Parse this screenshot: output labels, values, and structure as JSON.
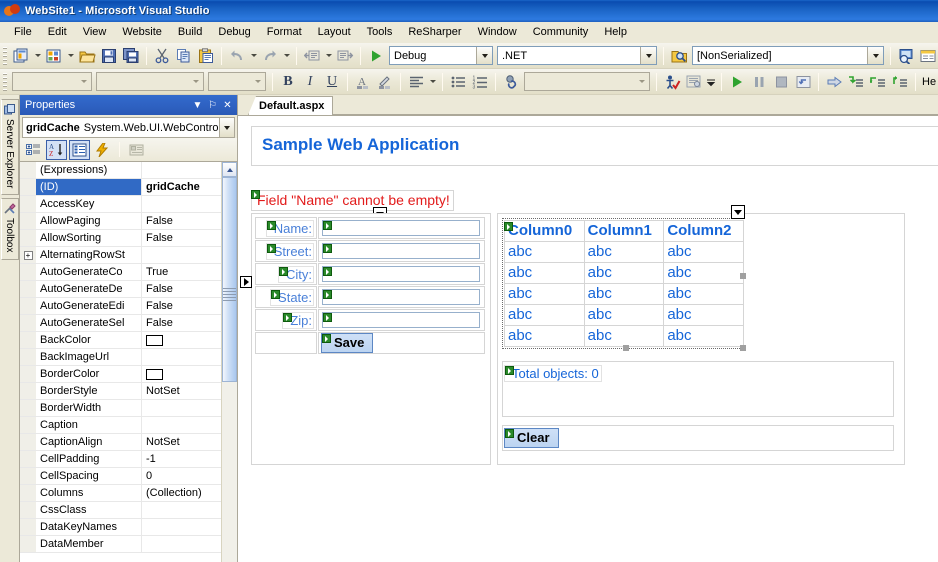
{
  "window": {
    "title": "WebSite1 - Microsoft Visual Studio",
    "logo_icon": "visual-studio-logo-icon"
  },
  "menubar": {
    "items": [
      {
        "label": "File"
      },
      {
        "label": "Edit"
      },
      {
        "label": "View"
      },
      {
        "label": "Website"
      },
      {
        "label": "Build"
      },
      {
        "label": "Debug"
      },
      {
        "label": "Format"
      },
      {
        "label": "Layout"
      },
      {
        "label": "Tools"
      },
      {
        "label": "ReSharper"
      },
      {
        "label": "Window"
      },
      {
        "label": "Community"
      },
      {
        "label": "Help"
      }
    ]
  },
  "toolbar_standard": {
    "buttons": [
      {
        "icon": "new-project-icon",
        "has_dropdown": true
      },
      {
        "icon": "new-item-icon",
        "has_dropdown": true
      },
      {
        "icon": "open-file-icon"
      },
      {
        "icon": "save-icon"
      },
      {
        "icon": "save-all-icon"
      },
      {
        "icon": "cut-icon"
      },
      {
        "icon": "copy-icon"
      },
      {
        "icon": "paste-icon"
      },
      {
        "icon": "undo-icon",
        "has_dropdown": true
      },
      {
        "icon": "redo-icon",
        "has_dropdown": true
      },
      {
        "icon": "navigate-backward-icon",
        "has_dropdown": true
      },
      {
        "icon": "navigate-forward-icon"
      },
      {
        "icon": "start-debugging-icon"
      }
    ],
    "config_combo": {
      "value": "Debug"
    },
    "platform_combo": {
      "value": ".NET"
    },
    "find_icon": "find-in-files-icon",
    "find_combo": {
      "value": "[NonSerialized]"
    },
    "right_buttons": [
      {
        "icon": "solution-explorer-icon"
      },
      {
        "icon": "properties-window-icon"
      },
      {
        "icon": "object-browser-icon"
      },
      {
        "icon": "toolbox-tools-icon"
      }
    ]
  },
  "toolbar_formatting": {
    "block_combo": {
      "value": ""
    },
    "font_combo": {
      "value": ""
    },
    "size_combo": {
      "value": ""
    },
    "buttons": [
      {
        "icon": "bold-icon",
        "label": "B"
      },
      {
        "icon": "italic-icon",
        "label": "I"
      },
      {
        "icon": "underline-icon",
        "label": "U"
      },
      {
        "icon": "foreground-color-icon"
      },
      {
        "icon": "background-color-icon"
      },
      {
        "icon": "align-left-icon",
        "has_dropdown": true
      },
      {
        "icon": "bullet-list-icon"
      },
      {
        "icon": "numbered-list-icon"
      },
      {
        "icon": "hyperlink-icon"
      }
    ],
    "style_combo": {
      "value": ""
    },
    "right_buttons": [
      {
        "icon": "accessibility-check-icon"
      },
      {
        "icon": "style-sheet-icon"
      },
      {
        "icon": "overflow-chevron-icon"
      },
      {
        "icon": "start-icon"
      },
      {
        "icon": "pause-icon"
      },
      {
        "icon": "stop-icon"
      },
      {
        "icon": "restart-icon"
      },
      {
        "icon": "show-next-statement-icon"
      },
      {
        "icon": "step-into-icon"
      },
      {
        "icon": "step-over-icon"
      },
      {
        "icon": "step-out-icon"
      }
    ],
    "trailing_label": "He"
  },
  "vertical_dock": {
    "tabs": [
      {
        "label": "Server Explorer",
        "icon": "server-explorer-icon"
      },
      {
        "label": "Toolbox",
        "icon": "toolbox-icon"
      }
    ]
  },
  "properties_panel": {
    "title": "Properties",
    "title_buttons": [
      {
        "icon": "window-menu-chevron-icon",
        "glyph": "▼"
      },
      {
        "icon": "auto-hide-pin-icon",
        "glyph": "⚐"
      },
      {
        "icon": "close-icon",
        "glyph": "✕"
      }
    ],
    "object_name": "gridCache",
    "object_type": "System.Web.UI.WebContro",
    "toolbar": [
      {
        "icon": "categorized-view-icon",
        "selected": false
      },
      {
        "icon": "alphabetical-sort-icon",
        "selected": true
      },
      {
        "icon": "properties-view-icon",
        "selected": true
      },
      {
        "icon": "events-view-icon",
        "selected": false
      },
      {
        "icon": "property-pages-icon",
        "selected": false
      }
    ],
    "columns": [
      "Property",
      "Value"
    ],
    "rows": [
      {
        "name": "(Expressions)",
        "value": "",
        "expandable": false,
        "selected": false,
        "type": "text"
      },
      {
        "name": "(ID)",
        "value": "gridCache",
        "expandable": false,
        "selected": true,
        "type": "text"
      },
      {
        "name": "AccessKey",
        "value": "",
        "expandable": false,
        "selected": false,
        "type": "text"
      },
      {
        "name": "AllowPaging",
        "value": "False",
        "expandable": false,
        "selected": false,
        "type": "text"
      },
      {
        "name": "AllowSorting",
        "value": "False",
        "expandable": false,
        "selected": false,
        "type": "text"
      },
      {
        "name": "AlternatingRowSt",
        "value": "",
        "expandable": true,
        "selected": false,
        "type": "text"
      },
      {
        "name": "AutoGenerateCo",
        "value": "True",
        "expandable": false,
        "selected": false,
        "type": "text"
      },
      {
        "name": "AutoGenerateDe",
        "value": "False",
        "expandable": false,
        "selected": false,
        "type": "text"
      },
      {
        "name": "AutoGenerateEdi",
        "value": "False",
        "expandable": false,
        "selected": false,
        "type": "text"
      },
      {
        "name": "AutoGenerateSel",
        "value": "False",
        "expandable": false,
        "selected": false,
        "type": "text"
      },
      {
        "name": "BackColor",
        "value": "",
        "expandable": false,
        "selected": false,
        "type": "color",
        "color": "#ffffff"
      },
      {
        "name": "BackImageUrl",
        "value": "",
        "expandable": false,
        "selected": false,
        "type": "text"
      },
      {
        "name": "BorderColor",
        "value": "",
        "expandable": false,
        "selected": false,
        "type": "color",
        "color": "#ffffff"
      },
      {
        "name": "BorderStyle",
        "value": "NotSet",
        "expandable": false,
        "selected": false,
        "type": "text"
      },
      {
        "name": "BorderWidth",
        "value": "",
        "expandable": false,
        "selected": false,
        "type": "text"
      },
      {
        "name": "Caption",
        "value": "",
        "expandable": false,
        "selected": false,
        "type": "text"
      },
      {
        "name": "CaptionAlign",
        "value": "NotSet",
        "expandable": false,
        "selected": false,
        "type": "text"
      },
      {
        "name": "CellPadding",
        "value": "-1",
        "expandable": false,
        "selected": false,
        "type": "text"
      },
      {
        "name": "CellSpacing",
        "value": "0",
        "expandable": false,
        "selected": false,
        "type": "text"
      },
      {
        "name": "Columns",
        "value": "(Collection)",
        "expandable": false,
        "selected": false,
        "type": "text"
      },
      {
        "name": "CssClass",
        "value": "",
        "expandable": false,
        "selected": false,
        "type": "text"
      },
      {
        "name": "DataKeyNames",
        "value": "",
        "expandable": false,
        "selected": false,
        "type": "text"
      },
      {
        "name": "DataMember",
        "value": "",
        "expandable": false,
        "selected": false,
        "type": "text"
      }
    ]
  },
  "document": {
    "tabs": [
      {
        "label": "Default.aspx",
        "active": true
      }
    ],
    "header_text": "Sample Web Application",
    "error_text": "Field \"Name\" cannot be empty!",
    "form": {
      "fields": [
        {
          "label": "Name:",
          "value": ""
        },
        {
          "label": "Street:",
          "value": ""
        },
        {
          "label": "City:",
          "value": ""
        },
        {
          "label": "State:",
          "value": ""
        },
        {
          "label": "Zip:",
          "value": ""
        }
      ],
      "save_button": "Save"
    },
    "grid": {
      "columns": [
        "Column0",
        "Column1",
        "Column2"
      ],
      "rows": [
        [
          "abc",
          "abc",
          "abc"
        ],
        [
          "abc",
          "abc",
          "abc"
        ],
        [
          "abc",
          "abc",
          "abc"
        ],
        [
          "abc",
          "abc",
          "abc"
        ],
        [
          "abc",
          "abc",
          "abc"
        ]
      ]
    },
    "total_text": "Total objects: 0",
    "clear_button": "Clear"
  },
  "colors": {
    "titlebar_blue": "#2a59b6",
    "link_blue": "#1565d8",
    "error_red": "#e21b1b",
    "chrome_beige": "#ece9d8",
    "selection_blue": "#316ac5"
  }
}
